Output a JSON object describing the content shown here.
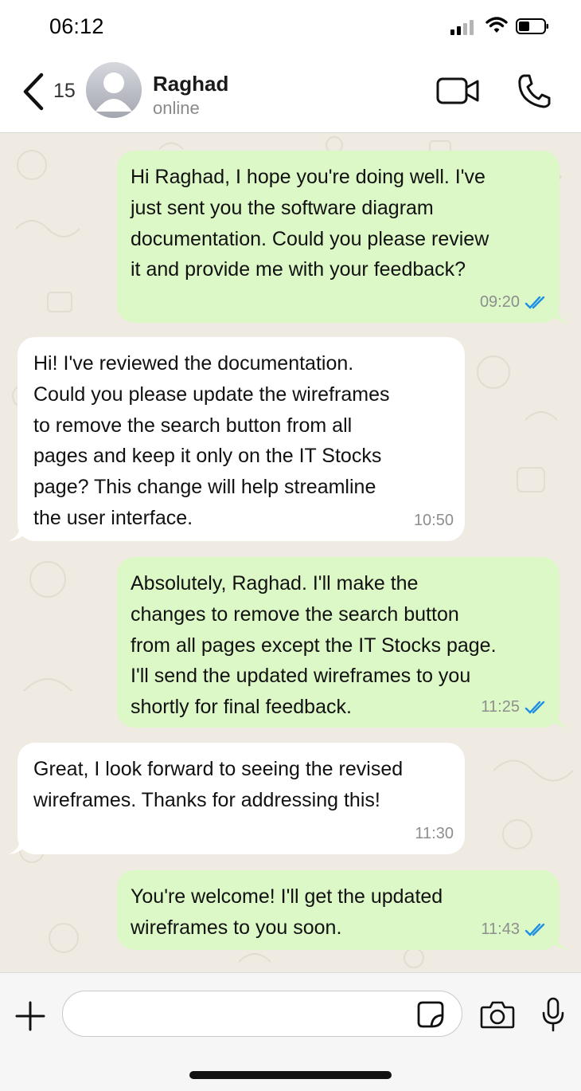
{
  "status_bar": {
    "time": "06:12"
  },
  "header": {
    "unread_count": "15",
    "contact_name": "Raghad",
    "contact_status": "online"
  },
  "messages": [
    {
      "direction": "out",
      "text": "Hi Raghad, I hope you're doing well. I've\njust sent you the software diagram\ndocumentation. Could you please review\nit and provide me with your feedback?",
      "time": "09:20",
      "read": true
    },
    {
      "direction": "in",
      "text": "Hi! I've reviewed the documentation.\nCould you please update the wireframes\nto remove the search button from all\npages and keep it only on the IT Stocks\npage? This change will help streamline\nthe user interface.",
      "time": "10:50"
    },
    {
      "direction": "out",
      "text": "Absolutely, Raghad. I'll make the\nchanges to remove the search button\nfrom all pages except the IT Stocks page.\nI'll send the updated wireframes to you\nshortly for final feedback.",
      "time": "11:25",
      "read": true
    },
    {
      "direction": "in",
      "text": "Great, I look forward to seeing the revised\nwireframes. Thanks for addressing this!",
      "time": "11:30"
    },
    {
      "direction": "out",
      "text": "You're welcome! I'll get the updated\nwireframes to you soon.",
      "time": "11:43",
      "read": true
    }
  ],
  "composer": {
    "placeholder": ""
  },
  "colors": {
    "outgoing_bubble": "#dcf8c6",
    "incoming_bubble": "#ffffff",
    "chat_background": "#efeae2",
    "read_ticks": "#1f8fe5"
  }
}
